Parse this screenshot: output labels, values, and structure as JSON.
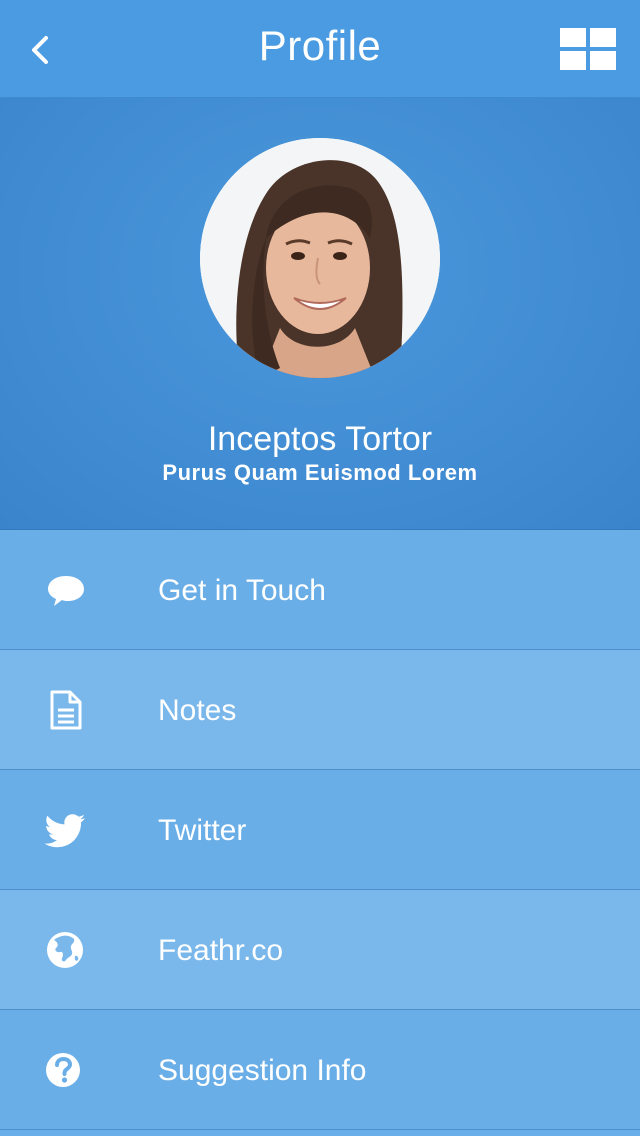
{
  "navbar": {
    "title": "Profile",
    "back_icon": "chevron-left-icon",
    "grid_icon": "grid-icon"
  },
  "profile": {
    "name": "Inceptos Tortor",
    "subtitle": "Purus Quam Euismod Lorem"
  },
  "menu": {
    "items": [
      {
        "label": "Get in Touch",
        "icon": "chat-bubble-icon"
      },
      {
        "label": "Notes",
        "icon": "document-icon"
      },
      {
        "label": "Twitter",
        "icon": "twitter-bird-icon"
      },
      {
        "label": "Feathr.co",
        "icon": "globe-icon"
      },
      {
        "label": "Suggestion Info",
        "icon": "question-icon"
      }
    ]
  },
  "colors": {
    "navbar": "#4a9be2",
    "hero": "#3f8ad1",
    "menu_base": "#6aaee8",
    "menu_alt": "#7ab8ec",
    "text": "#ffffff"
  }
}
